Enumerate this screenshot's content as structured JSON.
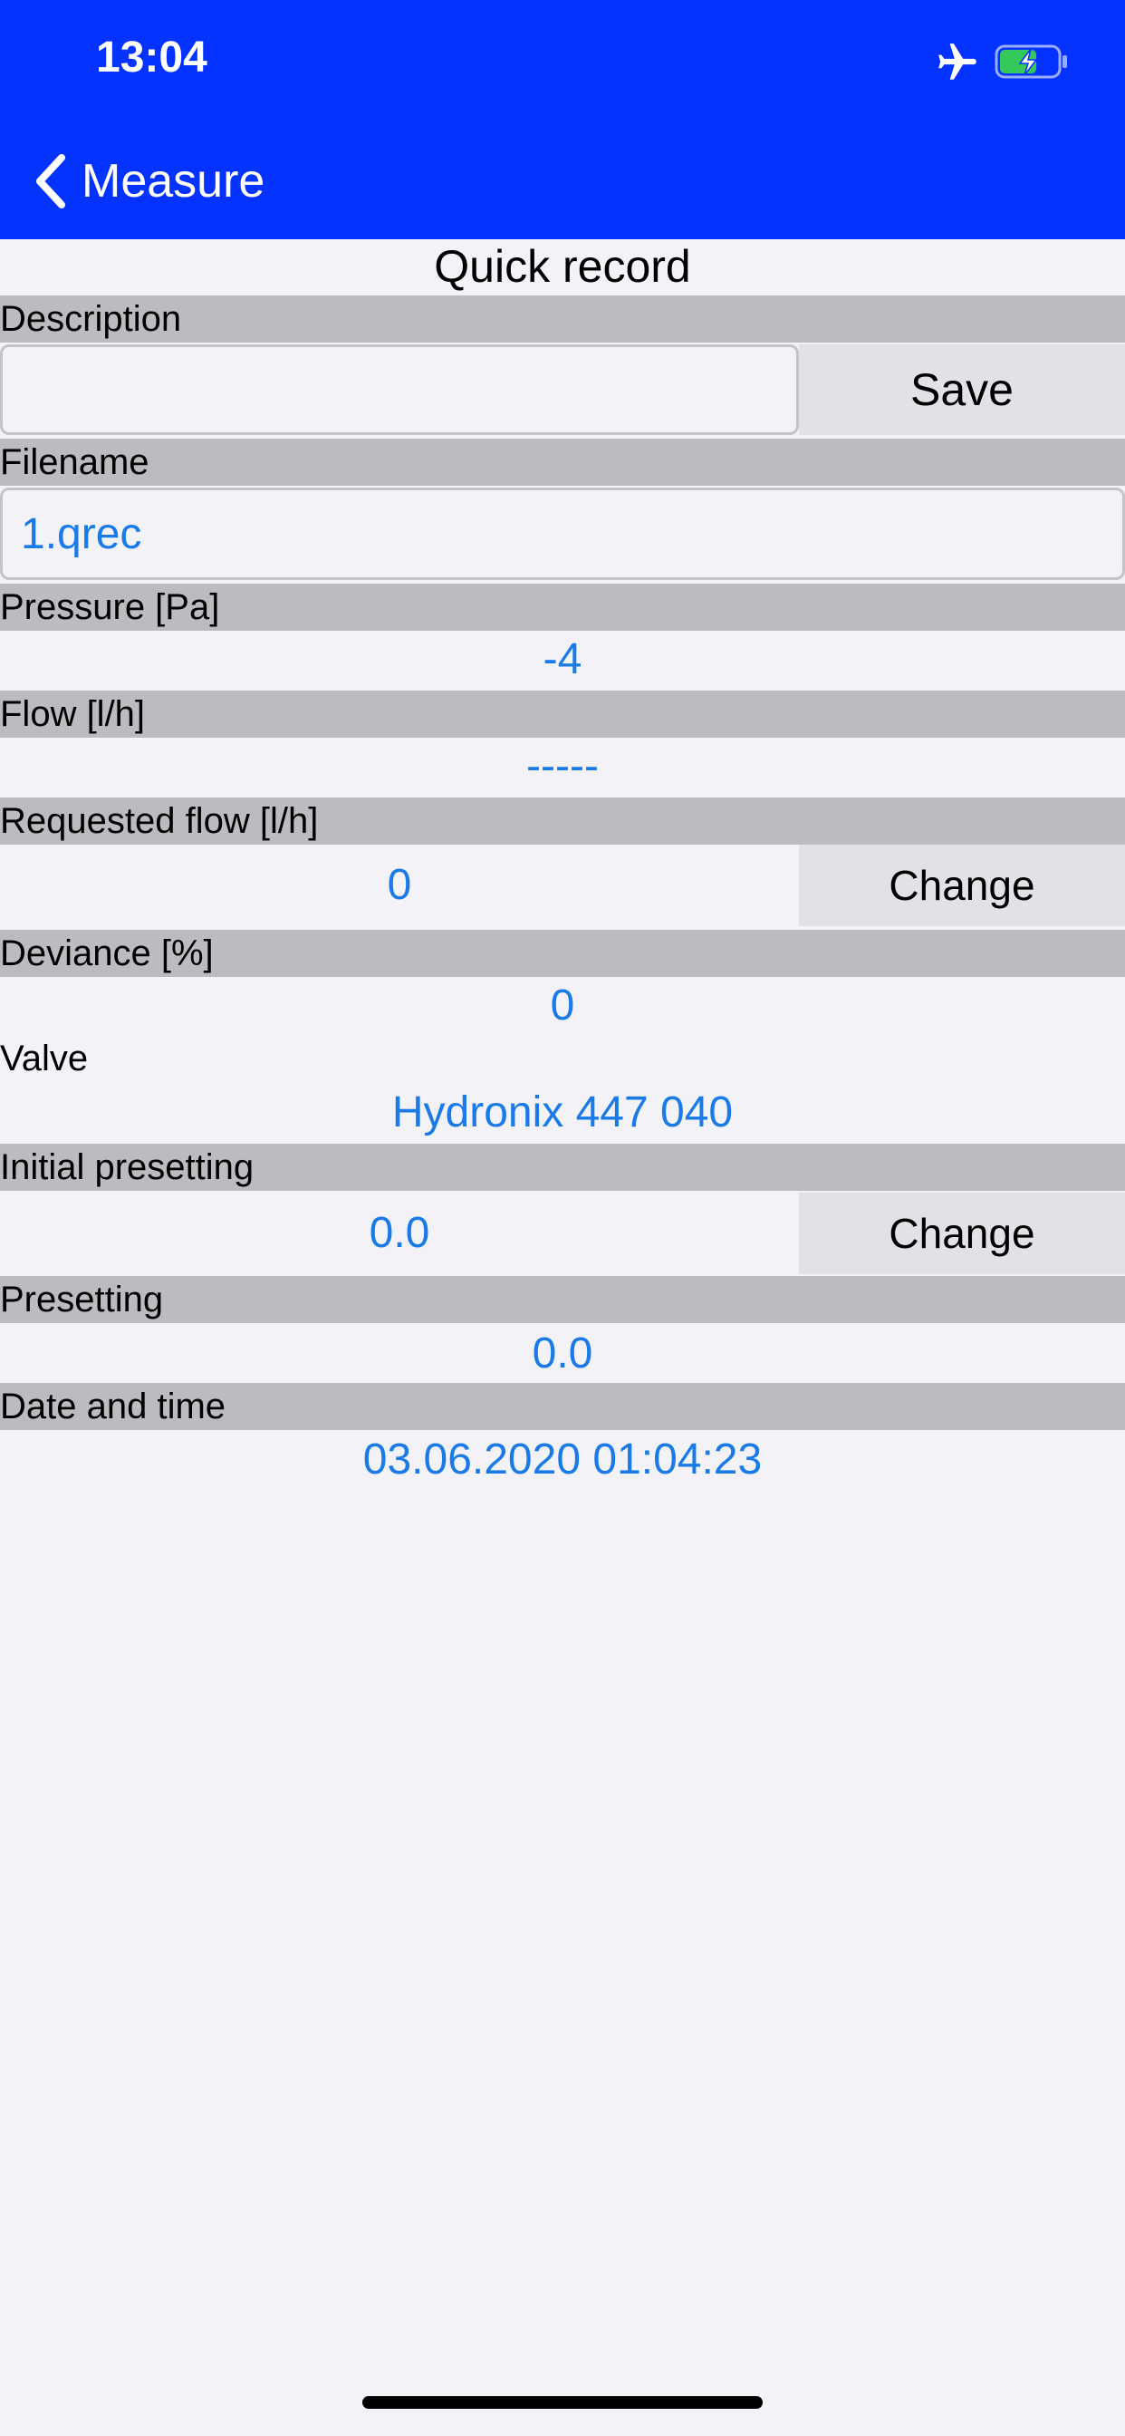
{
  "status_bar": {
    "time": "13:04",
    "icons": [
      "airplane-icon",
      "battery-charging-icon"
    ],
    "battery_color": "#34c759"
  },
  "nav": {
    "back_label": "Measure",
    "back_icon": "chevron-left-icon",
    "background_color": "#0433ff"
  },
  "page": {
    "title": "Quick record",
    "accent_color": "#1a7ae8"
  },
  "description": {
    "label": "Description",
    "value": "",
    "save_label": "Save"
  },
  "filename": {
    "label": "Filename",
    "value": "1.qrec"
  },
  "pressure": {
    "label": "Pressure [Pa]",
    "value": "-4"
  },
  "flow": {
    "label": "Flow [l/h]",
    "value": "-----"
  },
  "requested_flow": {
    "label": "Requested flow [l/h]",
    "value": "0",
    "change_label": "Change"
  },
  "deviance": {
    "label": "Deviance [%]",
    "value": "0"
  },
  "valve": {
    "label": "Valve",
    "value": "Hydronix 447 040"
  },
  "initial_presetting": {
    "label": "Initial presetting",
    "value": "0.0",
    "change_label": "Change"
  },
  "presetting": {
    "label": "Presetting",
    "value": "0.0"
  },
  "date_time": {
    "label": "Date and time",
    "value": "03.06.2020 01:04:23"
  }
}
